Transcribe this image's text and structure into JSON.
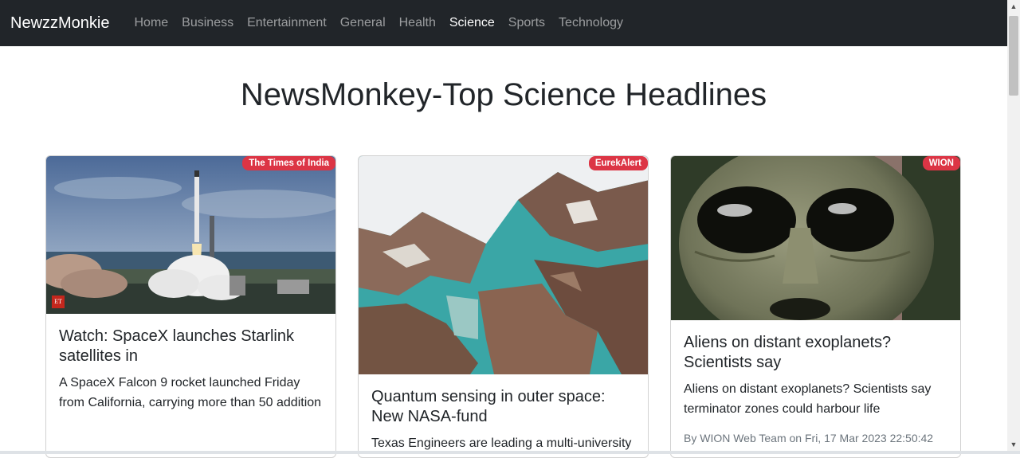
{
  "navbar": {
    "brand": "NewzzMonkie",
    "links": [
      "Home",
      "Business",
      "Entertainment",
      "General",
      "Health",
      "Science",
      "Sports",
      "Technology"
    ],
    "active": "Science"
  },
  "page_title": "NewsMonkey-Top Science Headlines",
  "colors": {
    "navbar_bg": "#212529",
    "badge_bg": "#dc3545",
    "text": "#212529",
    "muted": "#6c757d"
  },
  "cards": [
    {
      "source": "The Times of India",
      "title": "Watch: SpaceX launches Starlink satellites in",
      "description": "A SpaceX Falcon 9 rocket launched Friday from California, carrying more than 50 addition",
      "image_logo": "ET"
    },
    {
      "source": "EurekAlert",
      "title": "Quantum sensing in outer space: New NASA-fund",
      "description": "Texas Engineers are leading a multi-university"
    },
    {
      "source": "WION",
      "title": "Aliens on distant exoplanets? Scientists say",
      "description": "Aliens on distant exoplanets? Scientists say terminator zones could harbour life",
      "meta": "By WION Web Team on Fri, 17 Mar 2023 22:50:42"
    }
  ]
}
